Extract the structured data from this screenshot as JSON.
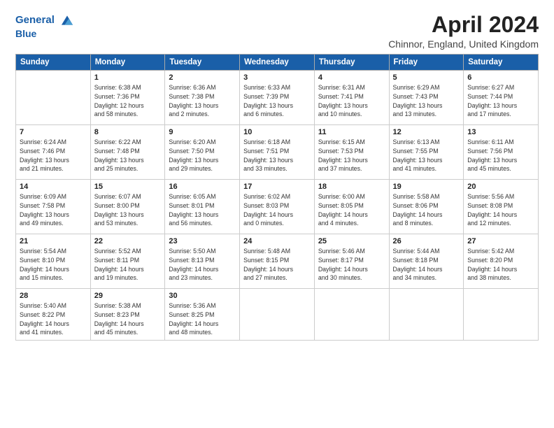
{
  "header": {
    "logo_line1": "General",
    "logo_line2": "Blue",
    "month": "April 2024",
    "location": "Chinnor, England, United Kingdom"
  },
  "columns": [
    "Sunday",
    "Monday",
    "Tuesday",
    "Wednesday",
    "Thursday",
    "Friday",
    "Saturday"
  ],
  "weeks": [
    [
      {
        "day": "",
        "info": ""
      },
      {
        "day": "1",
        "info": "Sunrise: 6:38 AM\nSunset: 7:36 PM\nDaylight: 12 hours\nand 58 minutes."
      },
      {
        "day": "2",
        "info": "Sunrise: 6:36 AM\nSunset: 7:38 PM\nDaylight: 13 hours\nand 2 minutes."
      },
      {
        "day": "3",
        "info": "Sunrise: 6:33 AM\nSunset: 7:39 PM\nDaylight: 13 hours\nand 6 minutes."
      },
      {
        "day": "4",
        "info": "Sunrise: 6:31 AM\nSunset: 7:41 PM\nDaylight: 13 hours\nand 10 minutes."
      },
      {
        "day": "5",
        "info": "Sunrise: 6:29 AM\nSunset: 7:43 PM\nDaylight: 13 hours\nand 13 minutes."
      },
      {
        "day": "6",
        "info": "Sunrise: 6:27 AM\nSunset: 7:44 PM\nDaylight: 13 hours\nand 17 minutes."
      }
    ],
    [
      {
        "day": "7",
        "info": "Sunrise: 6:24 AM\nSunset: 7:46 PM\nDaylight: 13 hours\nand 21 minutes."
      },
      {
        "day": "8",
        "info": "Sunrise: 6:22 AM\nSunset: 7:48 PM\nDaylight: 13 hours\nand 25 minutes."
      },
      {
        "day": "9",
        "info": "Sunrise: 6:20 AM\nSunset: 7:50 PM\nDaylight: 13 hours\nand 29 minutes."
      },
      {
        "day": "10",
        "info": "Sunrise: 6:18 AM\nSunset: 7:51 PM\nDaylight: 13 hours\nand 33 minutes."
      },
      {
        "day": "11",
        "info": "Sunrise: 6:15 AM\nSunset: 7:53 PM\nDaylight: 13 hours\nand 37 minutes."
      },
      {
        "day": "12",
        "info": "Sunrise: 6:13 AM\nSunset: 7:55 PM\nDaylight: 13 hours\nand 41 minutes."
      },
      {
        "day": "13",
        "info": "Sunrise: 6:11 AM\nSunset: 7:56 PM\nDaylight: 13 hours\nand 45 minutes."
      }
    ],
    [
      {
        "day": "14",
        "info": "Sunrise: 6:09 AM\nSunset: 7:58 PM\nDaylight: 13 hours\nand 49 minutes."
      },
      {
        "day": "15",
        "info": "Sunrise: 6:07 AM\nSunset: 8:00 PM\nDaylight: 13 hours\nand 53 minutes."
      },
      {
        "day": "16",
        "info": "Sunrise: 6:05 AM\nSunset: 8:01 PM\nDaylight: 13 hours\nand 56 minutes."
      },
      {
        "day": "17",
        "info": "Sunrise: 6:02 AM\nSunset: 8:03 PM\nDaylight: 14 hours\nand 0 minutes."
      },
      {
        "day": "18",
        "info": "Sunrise: 6:00 AM\nSunset: 8:05 PM\nDaylight: 14 hours\nand 4 minutes."
      },
      {
        "day": "19",
        "info": "Sunrise: 5:58 AM\nSunset: 8:06 PM\nDaylight: 14 hours\nand 8 minutes."
      },
      {
        "day": "20",
        "info": "Sunrise: 5:56 AM\nSunset: 8:08 PM\nDaylight: 14 hours\nand 12 minutes."
      }
    ],
    [
      {
        "day": "21",
        "info": "Sunrise: 5:54 AM\nSunset: 8:10 PM\nDaylight: 14 hours\nand 15 minutes."
      },
      {
        "day": "22",
        "info": "Sunrise: 5:52 AM\nSunset: 8:11 PM\nDaylight: 14 hours\nand 19 minutes."
      },
      {
        "day": "23",
        "info": "Sunrise: 5:50 AM\nSunset: 8:13 PM\nDaylight: 14 hours\nand 23 minutes."
      },
      {
        "day": "24",
        "info": "Sunrise: 5:48 AM\nSunset: 8:15 PM\nDaylight: 14 hours\nand 27 minutes."
      },
      {
        "day": "25",
        "info": "Sunrise: 5:46 AM\nSunset: 8:17 PM\nDaylight: 14 hours\nand 30 minutes."
      },
      {
        "day": "26",
        "info": "Sunrise: 5:44 AM\nSunset: 8:18 PM\nDaylight: 14 hours\nand 34 minutes."
      },
      {
        "day": "27",
        "info": "Sunrise: 5:42 AM\nSunset: 8:20 PM\nDaylight: 14 hours\nand 38 minutes."
      }
    ],
    [
      {
        "day": "28",
        "info": "Sunrise: 5:40 AM\nSunset: 8:22 PM\nDaylight: 14 hours\nand 41 minutes."
      },
      {
        "day": "29",
        "info": "Sunrise: 5:38 AM\nSunset: 8:23 PM\nDaylight: 14 hours\nand 45 minutes."
      },
      {
        "day": "30",
        "info": "Sunrise: 5:36 AM\nSunset: 8:25 PM\nDaylight: 14 hours\nand 48 minutes."
      },
      {
        "day": "",
        "info": ""
      },
      {
        "day": "",
        "info": ""
      },
      {
        "day": "",
        "info": ""
      },
      {
        "day": "",
        "info": ""
      }
    ]
  ]
}
